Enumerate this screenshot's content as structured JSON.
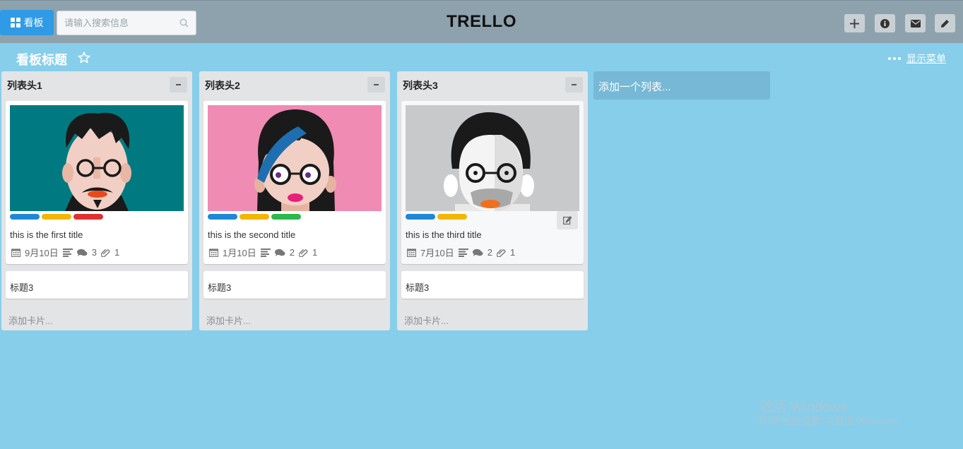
{
  "header": {
    "board_button_label": "看板",
    "search_placeholder": "请输入搜索信息",
    "app_title": "TRELLO"
  },
  "board": {
    "title": "看板标题",
    "menu_label": "显示菜单",
    "add_list_label": "添加一个列表..."
  },
  "lists": [
    {
      "header": "列表头1",
      "card": {
        "title": "this is the first title",
        "date": "9月10日",
        "comments": "3",
        "attachments": "1",
        "labels": [
          "#1e88d4",
          "#f2b705",
          "#e03030"
        ]
      },
      "card2_title": "标题3",
      "add_card_label": "添加卡片..."
    },
    {
      "header": "列表头2",
      "card": {
        "title": "this is the second title",
        "date": "1月10日",
        "comments": "2",
        "attachments": "1",
        "labels": [
          "#1e88d4",
          "#f2b705",
          "#2db84c"
        ]
      },
      "card2_title": "标题3",
      "add_card_label": "添加卡片..."
    },
    {
      "header": "列表头3",
      "card": {
        "title": "this is the third title",
        "date": "7月10日",
        "comments": "2",
        "attachments": "1",
        "labels": [
          "#1e88d4",
          "#f2b705"
        ]
      },
      "card2_title": "标题3",
      "add_card_label": "添加卡片..."
    }
  ],
  "watermark": {
    "line1": "激活 Windows",
    "line2": "转到“电脑设置”以激活 Windows。"
  },
  "colors": {
    "background": "#87ceeb",
    "header": "#8da2ad",
    "primary_button": "#2f9be6"
  }
}
